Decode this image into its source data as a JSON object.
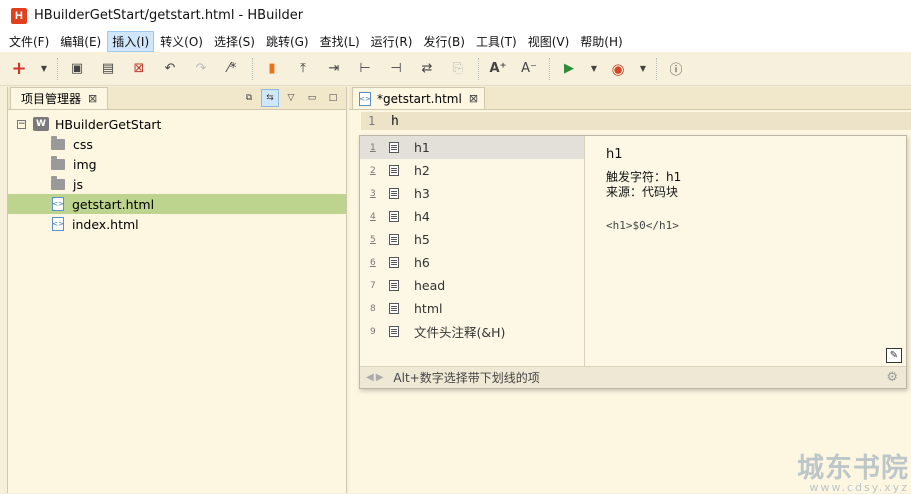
{
  "window": {
    "title": "HBuilderGetStart/getstart.html  -  HBuilder",
    "icon_letter": "H"
  },
  "menu": [
    {
      "label": "文件(F)"
    },
    {
      "label": "编辑(E)"
    },
    {
      "label": "插入(I)",
      "active": true
    },
    {
      "label": "转义(O)"
    },
    {
      "label": "选择(S)"
    },
    {
      "label": "跳转(G)"
    },
    {
      "label": "查找(L)"
    },
    {
      "label": "运行(R)"
    },
    {
      "label": "发行(B)"
    },
    {
      "label": "工具(T)"
    },
    {
      "label": "视图(V)"
    },
    {
      "label": "帮助(H)"
    }
  ],
  "toolbar_icons": [
    "new-icon",
    "save-icon",
    "save-all-icon",
    "close-icon",
    "undo-icon",
    "redo-icon",
    "format-icon",
    "bookmark-icon",
    "comment-icon",
    "indent-icon",
    "move-icon",
    "wrap-icon",
    "outline-icon",
    "disabled-icon",
    "font-increase-icon",
    "font-decrease-icon",
    "run-icon",
    "browser-icon",
    "info-icon"
  ],
  "left_panel": {
    "tab_label": "项目管理器",
    "tree": [
      {
        "label": "HBuilderGetStart",
        "type": "project",
        "icon_letter": "W"
      },
      {
        "label": "css",
        "type": "folder"
      },
      {
        "label": "img",
        "type": "folder"
      },
      {
        "label": "js",
        "type": "folder"
      },
      {
        "label": "getstart.html",
        "type": "file",
        "selected": true
      },
      {
        "label": "index.html",
        "type": "file"
      }
    ]
  },
  "editor": {
    "tab_label": "*getstart.html",
    "line_number": "1",
    "code": "h"
  },
  "autocomplete": {
    "items": [
      {
        "num": "1",
        "label": "h1"
      },
      {
        "num": "2",
        "label": "h2"
      },
      {
        "num": "3",
        "label": "h3"
      },
      {
        "num": "4",
        "label": "h4"
      },
      {
        "num": "5",
        "label": "h5"
      },
      {
        "num": "6",
        "label": "h6"
      },
      {
        "num": "7",
        "label": "head"
      },
      {
        "num": "8",
        "label": "html"
      },
      {
        "num": "9",
        "label": "文件头注释(&H)"
      }
    ],
    "detail": {
      "title": "h1",
      "trigger": "触发字符：h1",
      "source": "来源：代码块",
      "snippet": "<h1>$0</h1>"
    },
    "footer": "Alt+数字选择带下划线的项"
  },
  "watermark": {
    "main": "城东书院",
    "sub": "www.cdsy.xyz"
  }
}
